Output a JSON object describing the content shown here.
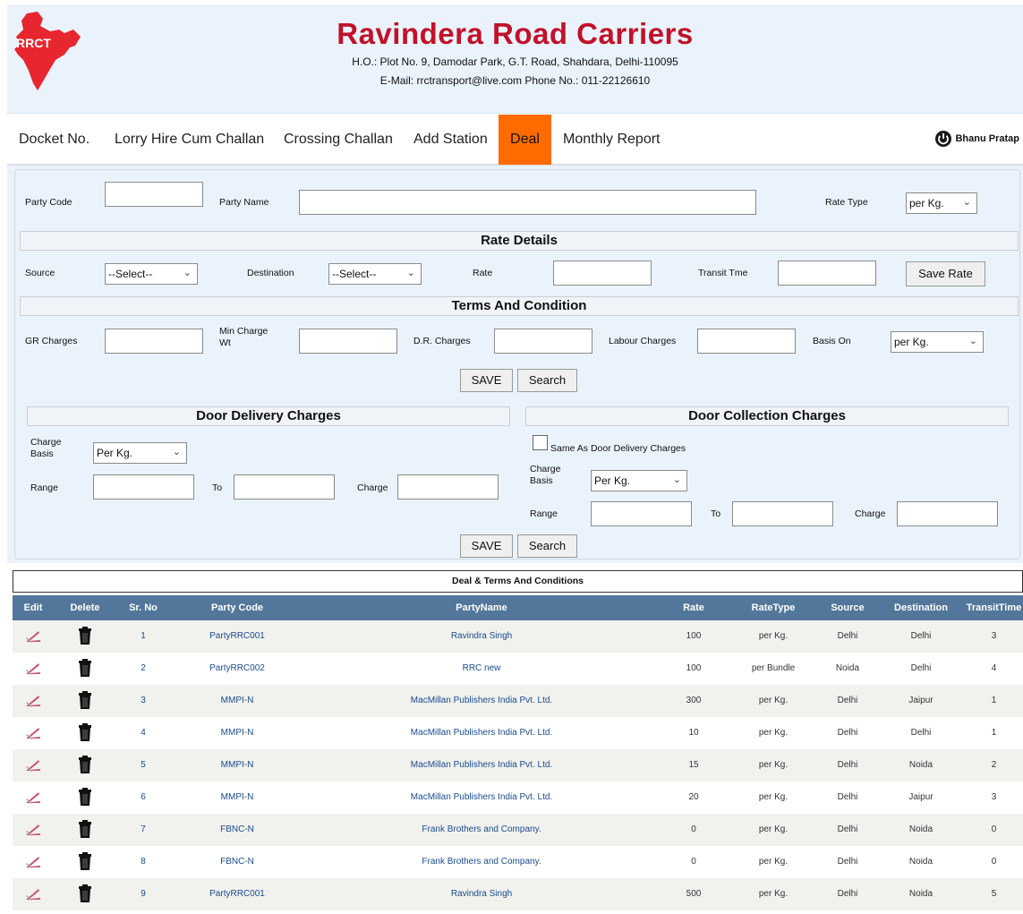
{
  "header": {
    "logo_text": "RRCT",
    "company": "Ravindera Road Carriers",
    "address": "H.O.: Plot No. 9, Damodar Park, G.T. Road, Shahdara, Delhi-110095",
    "contact": "E-Mail: rrctransport@live.com Phone No.: 011-22126610"
  },
  "nav": {
    "items": [
      "Docket No.",
      "Lorry Hire Cum Challan",
      "Crossing Challan",
      "Add Station",
      "Deal",
      "Monthly Report"
    ],
    "active": "Deal",
    "user": "Bhanu Pratap"
  },
  "party": {
    "code_label": "Party Code",
    "code_value": "",
    "name_label": "Party Name",
    "name_value": "",
    "rate_type_label": "Rate Type",
    "rate_type_value": "per Kg."
  },
  "rate_details": {
    "title": "Rate Details",
    "source_label": "Source",
    "source_value": "--Select--",
    "destination_label": "Destination",
    "destination_value": "--Select--",
    "rate_label": "Rate",
    "rate_value": "",
    "transit_label": "Transit Tme",
    "transit_value": "",
    "save_rate": "Save Rate"
  },
  "terms": {
    "title": "Terms And Condition",
    "gr_label": "GR Charges",
    "min_label_1": "Min Charge",
    "min_label_2": "Wt",
    "dr_label": "D.R. Charges",
    "labour_label": "Labour Charges",
    "basis_label": "Basis On",
    "basis_value": "per Kg.",
    "save": "SAVE",
    "search": "Search"
  },
  "door_delivery": {
    "title": "Door Delivery Charges",
    "basis_label_1": "Charge",
    "basis_label_2": "Basis",
    "basis_value": "Per Kg.",
    "range_label": "Range",
    "to_label": "To",
    "charge_label": "Charge"
  },
  "door_collection": {
    "title": "Door Collection Charges",
    "same_label": "Same As Door Delivery Charges",
    "basis_label_1": "Charge",
    "basis_label_2": "Basis",
    "basis_value": "Per Kg.",
    "range_label": "Range",
    "to_label": "To",
    "charge_label": "Charge",
    "save": "SAVE",
    "search": "Search"
  },
  "table": {
    "title": "Deal & Terms And Conditions",
    "columns": [
      "Edit",
      "Delete",
      "Sr. No",
      "Party Code",
      "PartyName",
      "Rate",
      "RateType",
      "Source",
      "Destination",
      "TransitTime"
    ],
    "rows": [
      [
        "1",
        "PartyRRC001",
        "Ravindra Singh",
        "100",
        "per Kg.",
        "Delhi",
        "Delhi",
        "3"
      ],
      [
        "2",
        "PartyRRC002",
        "RRC new",
        "100",
        "per Bundle",
        "Noida",
        "Delhi",
        "4"
      ],
      [
        "3",
        "MMPI-N",
        "MacMillan Publishers India Pvt. Ltd.",
        "300",
        "per Kg.",
        "Delhi",
        "Jaipur",
        "1"
      ],
      [
        "4",
        "MMPI-N",
        "MacMillan Publishers India Pvt. Ltd.",
        "10",
        "per Kg.",
        "Delhi",
        "Delhi",
        "1"
      ],
      [
        "5",
        "MMPI-N",
        "MacMillan Publishers India Pvt. Ltd.",
        "15",
        "per Kg.",
        "Delhi",
        "Noida",
        "2"
      ],
      [
        "6",
        "MMPI-N",
        "MacMillan Publishers India Pvt. Ltd.",
        "20",
        "per Kg.",
        "Delhi",
        "Jaipur",
        "3"
      ],
      [
        "7",
        "FBNC-N",
        "Frank Brothers and Company.",
        "0",
        "per Kg.",
        "Delhi",
        "Noida",
        "0"
      ],
      [
        "8",
        "FBNC-N",
        "Frank Brothers and Company.",
        "0",
        "per Kg.",
        "Delhi",
        "Noida",
        "0"
      ],
      [
        "9",
        "PartyRRC001",
        "Ravindra Singh",
        "500",
        "per Kg.",
        "Delhi",
        "Noida",
        "5"
      ]
    ]
  },
  "colors": {
    "brand": "#c2112a",
    "active_tab": "#ff6b00",
    "table_header": "#53779b",
    "panel_bg": "#eaf3fb"
  }
}
